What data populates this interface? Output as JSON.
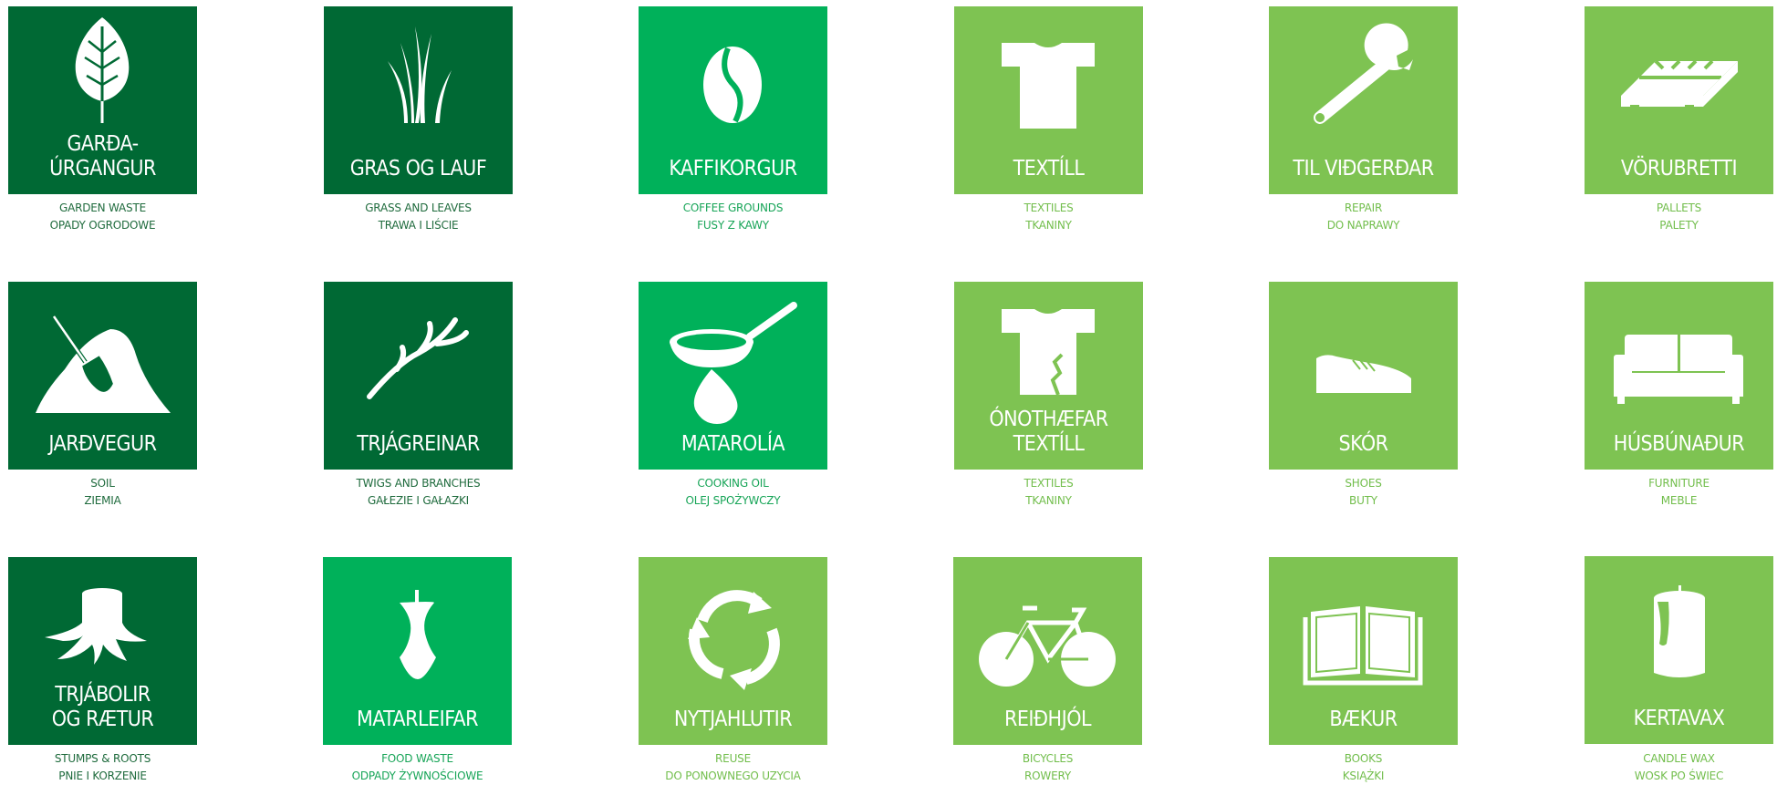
{
  "colors": {
    "dark": "#006934",
    "mid": "#00b15a",
    "light": "#7ec352"
  },
  "tiles": [
    {
      "title": "GARÐA-\nÚRGANGUR",
      "caption": "GARDEN WASTE\nOPADY OGRODOWE",
      "icon": "leaf-icon",
      "color": "dark"
    },
    {
      "title": "GRAS OG LAUF",
      "caption": "GRASS AND LEAVES\nTRAWA I LIŚCIE",
      "icon": "grass-icon",
      "color": "dark"
    },
    {
      "title": "KAFFIKORGUR",
      "caption": "COFFEE GROUNDS\nFUSY Z KAWY",
      "icon": "coffee-bean-icon",
      "color": "mid"
    },
    {
      "title": "TEXTÍLL",
      "caption": "TEXTILES\nTKANINY",
      "icon": "tshirt-icon",
      "color": "light"
    },
    {
      "title": "TIL VIÐGERÐAR",
      "caption": "REPAIR\nDO NAPRAWY",
      "icon": "wrench-icon",
      "color": "light"
    },
    {
      "title": "VÖRUBRETTI",
      "caption": "PALLETS\nPALETY",
      "icon": "pallet-icon",
      "color": "light"
    },
    {
      "title": "JARÐVEGUR",
      "caption": "SOIL\nZIEMIA",
      "icon": "shovel-soil-icon",
      "color": "dark"
    },
    {
      "title": "TRJÁGREINAR",
      "caption": "TWIGS AND BRANCHES\nGAŁEZIE I GAŁAZKI",
      "icon": "branch-icon",
      "color": "dark"
    },
    {
      "title": "MATAROLÍA",
      "caption": "COOKING OIL\nOLEJ SPOŻYWCZY",
      "icon": "frying-pan-oil-icon",
      "color": "mid"
    },
    {
      "title": "ÓNOTHÆFAR\nTEXTÍLL",
      "caption": "TEXTILES\nTKANINY",
      "icon": "torn-tshirt-icon",
      "color": "light"
    },
    {
      "title": "SKÓR",
      "caption": "SHOES\nBUTY",
      "icon": "shoe-icon",
      "color": "light"
    },
    {
      "title": "HÚSBÚNAÐUR",
      "caption": "FURNITURE\nMEBLE",
      "icon": "sofa-icon",
      "color": "light"
    },
    {
      "title": "TRJÁBOLIR\nOG RÆTUR",
      "caption": "STUMPS & ROOTS\nPNIE I KORZENIE",
      "icon": "stump-icon",
      "color": "dark"
    },
    {
      "title": "MATARLEIFAR",
      "caption": "FOOD WASTE\nODPADY ŻYWNOŚCIOWE",
      "icon": "apple-core-icon",
      "color": "mid"
    },
    {
      "title": "NYTJAHLUTIR",
      "caption": "REUSE\nDO PONOWNEGO UZYCIA",
      "icon": "recycle-icon",
      "color": "light"
    },
    {
      "title": "REIÐHJÓL",
      "caption": "BICYCLES\nROWERY",
      "icon": "bicycle-icon",
      "color": "light"
    },
    {
      "title": "BÆKUR",
      "caption": "BOOKS\nKSIĄŻKI",
      "icon": "book-icon",
      "color": "light"
    },
    {
      "title": "KERTAVAX",
      "caption": "CANDLE WAX\nWOSK PO ŚWIEC",
      "icon": "candle-icon",
      "color": "light"
    }
  ]
}
